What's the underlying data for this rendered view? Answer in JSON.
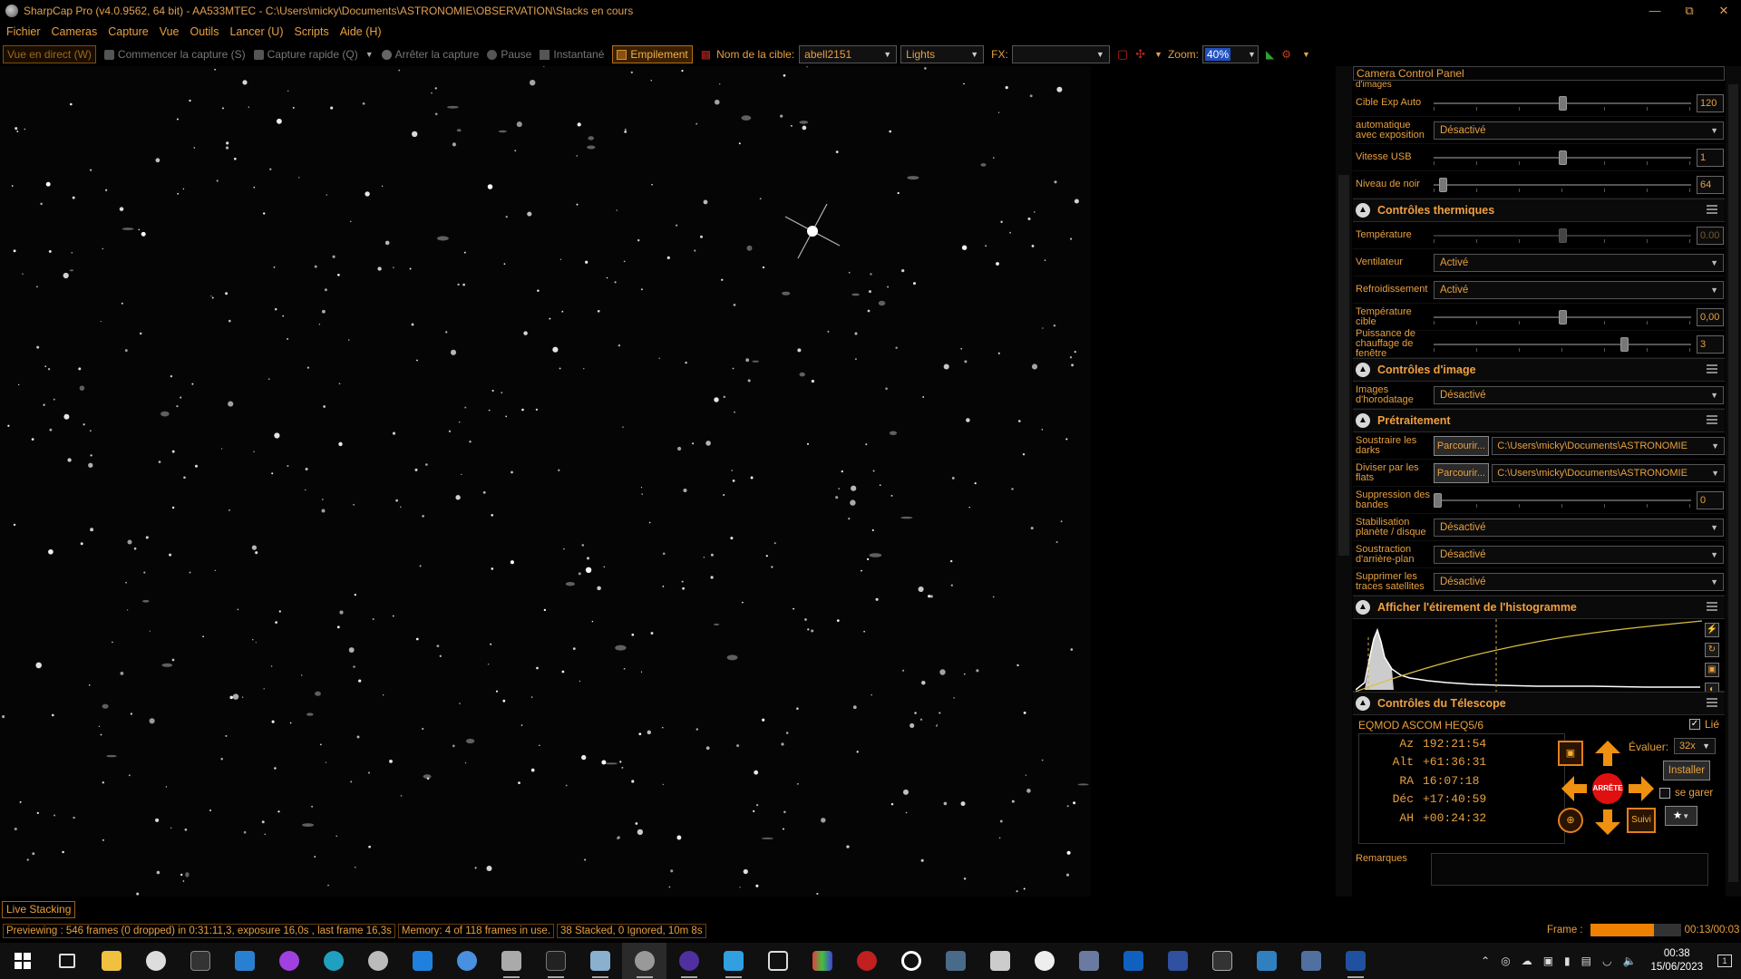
{
  "window": {
    "title": "SharpCap Pro (v4.0.9562, 64 bit) - AA533MTEC - C:\\Users\\micky\\Documents\\ASTRONOMIE\\OBSERVATION\\Stacks en cours",
    "controls": [
      "minimize",
      "restore",
      "close"
    ]
  },
  "menu": [
    "Fichier",
    "Cameras",
    "Capture",
    "Vue",
    "Outils",
    "Lancer (U)",
    "Scripts",
    "Aide (H)"
  ],
  "toolbar": {
    "live_view": "Vue en direct (W)",
    "start_capture": "Commencer la capture (S)",
    "quick_capture": "Capture rapide (Q)",
    "stop_capture": "Arrêter la capture",
    "pause": "Pause",
    "snapshot": "Instantané",
    "stacking": "Empilement",
    "target_label": "Nom de la cible:",
    "target_value": "abell2151",
    "frame_type": "Lights",
    "fx_label": "FX:",
    "fx_value": "",
    "zoom_label": "Zoom:",
    "zoom_value": "40%"
  },
  "panel": {
    "title": "Camera Control Panel",
    "cut_label": "d'images",
    "exposure_rows": [
      {
        "label": "Cible Exp Auto",
        "value": "120",
        "position": 0.5,
        "dim": false
      },
      {
        "label": "automatique avec exposition",
        "dropdown": "Désactivé"
      },
      {
        "label": "Vitesse USB",
        "value": "1",
        "position": 0.5,
        "dim": false
      },
      {
        "label": "Niveau de noir",
        "value": "64",
        "position": 0.02,
        "dim": false
      }
    ],
    "thermal": {
      "title": "Contrôles thermiques",
      "temperature_label": "Température",
      "temperature_value": "0.00",
      "temperature_position": 0.5,
      "fan_label": "Ventilateur",
      "fan_value": "Activé",
      "cooling_label": "Refroidissement",
      "cooling_value": "Activé",
      "target_temp_label": "Température cible",
      "target_temp_value": "0,00",
      "target_temp_position": 0.5,
      "heater_label": "Puissance de chauffage de fenêtre",
      "heater_value": "3",
      "heater_position": 0.75
    },
    "image": {
      "title": "Contrôles d'image",
      "timestamp_label": "Images d'horodatage",
      "timestamp_value": "Désactivé"
    },
    "preprocessing": {
      "title": "Prétraitement",
      "darks_label": "Soustraire les darks",
      "darks_button": "Parcourir...",
      "darks_path": "C:\\Users\\micky\\Documents\\ASTRONOMIE",
      "flats_label": "Diviser par les flats",
      "flats_button": "Parcourir...",
      "flats_path": "C:\\Users\\micky\\Documents\\ASTRONOMIE",
      "banding_label": "Suppression des bandes",
      "banding_value": "0",
      "banding_position": 0.0,
      "stab_label": "Stabilisation planète / disque",
      "stab_value": "Désactivé",
      "bg_label": "Soustraction d'arrière-plan",
      "bg_value": "Désactivé",
      "sat_label": "Supprimer les traces satellites",
      "sat_value": "Désactivé"
    },
    "histogram": {
      "title": "Afficher l'étirement de l'histogramme"
    },
    "telescope": {
      "title": "Contrôles du Télescope",
      "mount": "EQMOD ASCOM HEQ5/6",
      "linked_label": "Lié",
      "linked": true,
      "coords": [
        {
          "k": "Az",
          "v": "192:21:54"
        },
        {
          "k": "Alt",
          "v": "+61:36:31"
        },
        {
          "k": "RA",
          "v": "16:07:18"
        },
        {
          "k": "Déc",
          "v": "+17:40:59"
        },
        {
          "k": "AH",
          "v": "+00:24:32"
        }
      ],
      "stop_label": "ARRÊTE",
      "rate_label": "Évaluer:",
      "rate_value": "32x",
      "install_button": "Installer",
      "park_label": "se garer",
      "track_button": "Suivi"
    },
    "notes_label": "Remarques"
  },
  "live_stacking_tab": "Live Stacking",
  "status": {
    "preview": "Previewing : 546 frames (0 dropped) in 0:31:11,3, exposure 16,0s , last frame 16,3s",
    "memory": "Memory: 4 of 118 frames in use.",
    "stacked": "38 Stacked, 0 Ignored, 10m 8s",
    "frame_label": "Frame :",
    "frame_progress": 0.7,
    "frame_time": "00:13/00:03"
  },
  "taskbar": {
    "time": "00:38",
    "date": "15/06/2023",
    "notification_count": "1"
  },
  "colors": {
    "accent": "#e8a040",
    "orange_bright": "#f08000",
    "stop_red": "#e01010"
  }
}
